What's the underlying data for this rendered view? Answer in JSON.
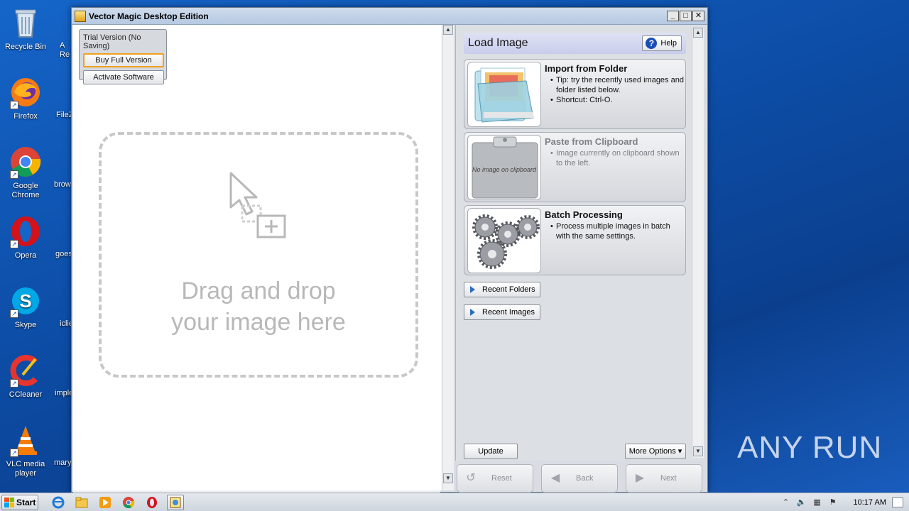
{
  "desktop": {
    "icons": [
      {
        "label": "Recycle Bin"
      },
      {
        "label": "Firefox"
      },
      {
        "label": "Google Chrome"
      },
      {
        "label": "Opera"
      },
      {
        "label": "Skype"
      },
      {
        "label": "CCleaner"
      },
      {
        "label": "VLC media player"
      }
    ],
    "partial_icons": [
      "A\nRe",
      "FileZ",
      "brow",
      "goes",
      "iclie",
      "imple",
      "mary"
    ],
    "watermark": "ANY RUN"
  },
  "window": {
    "title": "Vector Magic Desktop Edition",
    "controls": {
      "minimize": "_",
      "maximize": "□",
      "close": "✕"
    }
  },
  "trial": {
    "label": "Trial Version (No Saving)",
    "buy_label": "Buy Full Version",
    "activate_label": "Activate Software"
  },
  "dropzone": {
    "line1": "Drag and drop",
    "line2": "your image here"
  },
  "panel": {
    "title": "Load Image",
    "help_label": "Help",
    "options": [
      {
        "title": "Import from Folder",
        "bullets": [
          "Tip: try the recently used images and folder listed below.",
          "Shortcut: Ctrl-O."
        ],
        "enabled": true
      },
      {
        "title": "Paste from Clipboard",
        "bullets": [
          "Image currently on clipboard shown to the left."
        ],
        "thumb_text": "No image on clipboard",
        "enabled": false
      },
      {
        "title": "Batch Processing",
        "bullets": [
          "Process multiple images in batch with the same settings."
        ],
        "enabled": true
      }
    ],
    "recent_folders_label": "Recent Folders",
    "recent_images_label": "Recent Images",
    "update_label": "Update",
    "more_options_label": "More Options"
  },
  "nav": {
    "reset_label": "Reset",
    "back_label": "Back",
    "next_label": "Next"
  },
  "taskbar": {
    "start_label": "Start",
    "clock": "10:17 AM"
  },
  "colors": {
    "desktop_bg": "#1565c9",
    "accent_help": "#1a4fb8",
    "highlight_border": "#f0a020"
  }
}
